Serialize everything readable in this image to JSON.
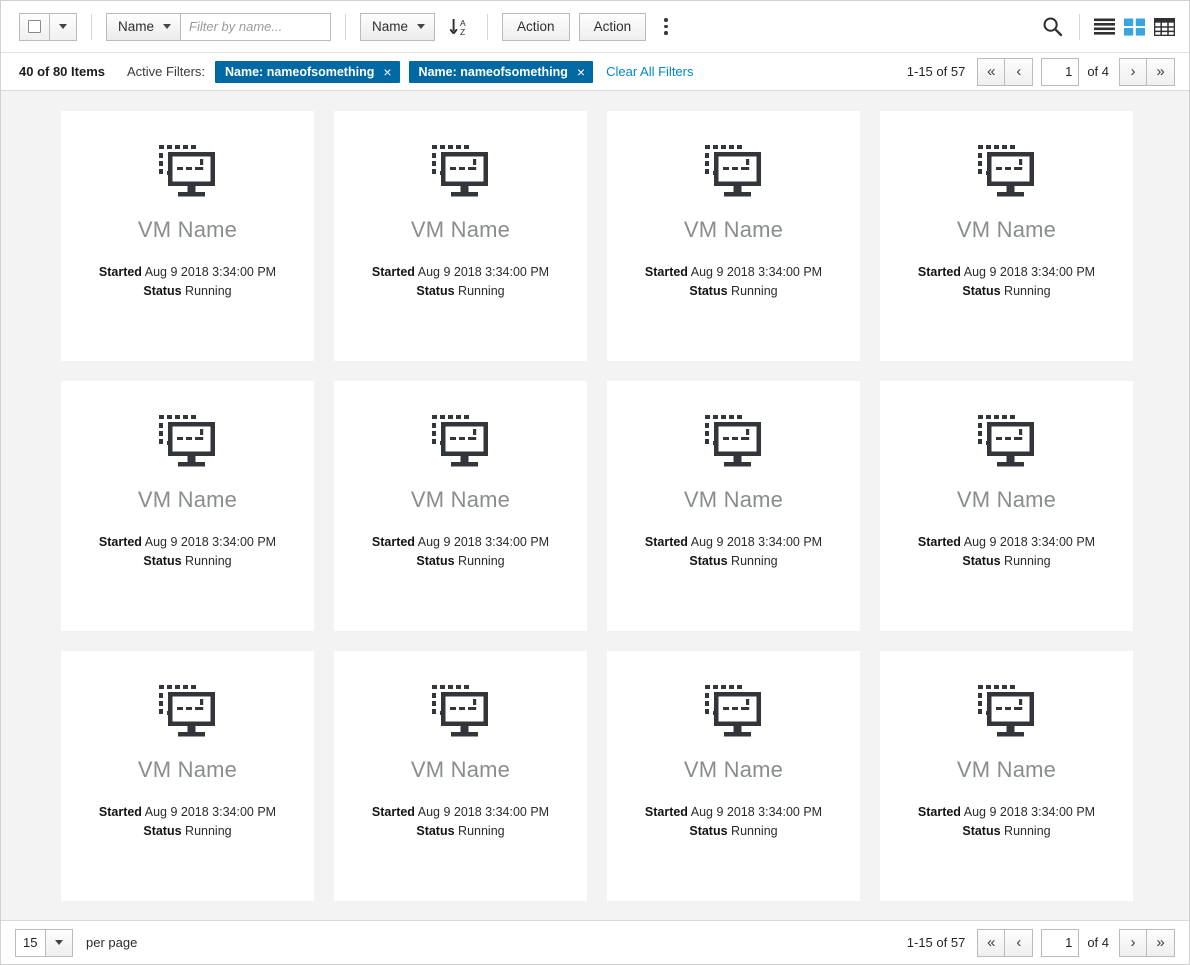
{
  "toolbar": {
    "select_all_checkbox": "",
    "filter_field": {
      "label": "Name",
      "placeholder": "Filter by name...",
      "value": ""
    },
    "sort_field": {
      "label": "Name"
    },
    "sort_direction_icon": "sort-alpha-asc-icon",
    "actions": [
      {
        "label": "Action"
      },
      {
        "label": "Action"
      }
    ],
    "kebab_icon": "kebab-menu-icon",
    "search_icon": "search-icon",
    "view_modes": [
      {
        "name": "list-view",
        "icon": "list-view-icon",
        "active": false
      },
      {
        "name": "card-view",
        "icon": "card-view-icon",
        "active": true
      },
      {
        "name": "table-view",
        "icon": "table-view-icon",
        "active": false
      }
    ],
    "active_view_color": "#39a5dc"
  },
  "filterbar": {
    "items_count": "40 of 80 Items",
    "active_filters_label": "Active Filters:",
    "chips": [
      {
        "label": "Name: nameofsomething",
        "remove": "×"
      },
      {
        "label": "Name: nameofsomething",
        "remove": "×"
      }
    ],
    "clear_all_label": "Clear All Filters",
    "chip_color": "#0069a3",
    "link_color": "#0088ce"
  },
  "pagination_top": {
    "range": "1-15 of 57",
    "first_label": "«",
    "prev_label": "‹",
    "page_value": "1",
    "of_label": "of 4",
    "next_label": "›",
    "last_label": "»"
  },
  "pagination_bottom": {
    "range": "1-15 of 57",
    "first_label": "«",
    "prev_label": "‹",
    "page_value": "1",
    "of_label": "of 4",
    "next_label": "›",
    "last_label": "»"
  },
  "footer": {
    "per_page_value": "15",
    "per_page_label": "per page"
  },
  "cards": {
    "icon": "virtual-machine-icon",
    "started_label": "Started",
    "status_label": "Status",
    "items": [
      {
        "title": "VM Name",
        "started": "Aug 9 2018 3:34:00 PM",
        "status": "Running"
      },
      {
        "title": "VM Name",
        "started": "Aug 9 2018 3:34:00 PM",
        "status": "Running"
      },
      {
        "title": "VM Name",
        "started": "Aug 9 2018 3:34:00 PM",
        "status": "Running"
      },
      {
        "title": "VM Name",
        "started": "Aug 9 2018 3:34:00 PM",
        "status": "Running"
      },
      {
        "title": "VM Name",
        "started": "Aug 9 2018 3:34:00 PM",
        "status": "Running"
      },
      {
        "title": "VM Name",
        "started": "Aug 9 2018 3:34:00 PM",
        "status": "Running"
      },
      {
        "title": "VM Name",
        "started": "Aug 9 2018 3:34:00 PM",
        "status": "Running"
      },
      {
        "title": "VM Name",
        "started": "Aug 9 2018 3:34:00 PM",
        "status": "Running"
      },
      {
        "title": "VM Name",
        "started": "Aug 9 2018 3:34:00 PM",
        "status": "Running"
      },
      {
        "title": "VM Name",
        "started": "Aug 9 2018 3:34:00 PM",
        "status": "Running"
      },
      {
        "title": "VM Name",
        "started": "Aug 9 2018 3:34:00 PM",
        "status": "Running"
      },
      {
        "title": "VM Name",
        "started": "Aug 9 2018 3:34:00 PM",
        "status": "Running"
      }
    ]
  }
}
